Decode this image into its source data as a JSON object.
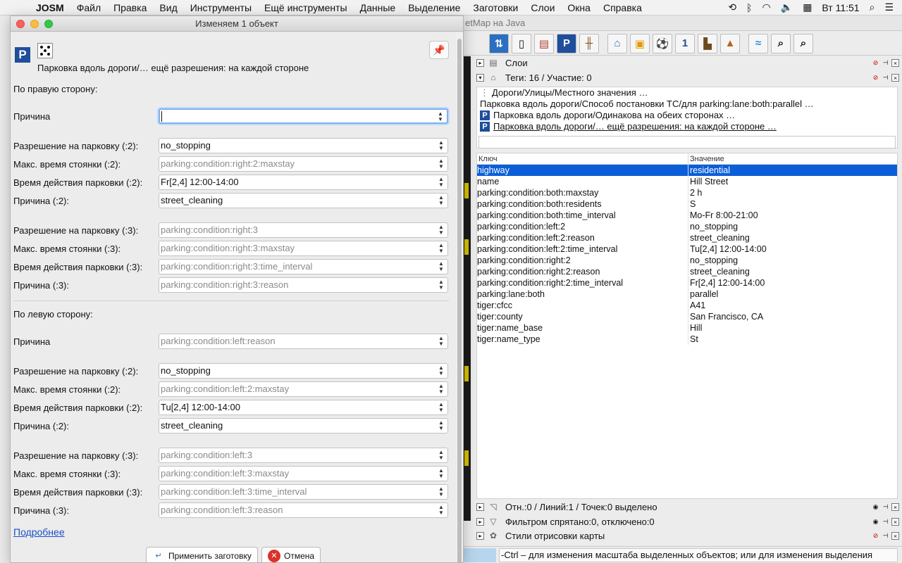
{
  "menubar": {
    "app": "JOSM",
    "items": [
      "Файл",
      "Правка",
      "Вид",
      "Инструменты",
      "Ещё инструменты",
      "Данные",
      "Выделение",
      "Заготовки",
      "Слои",
      "Окна",
      "Справка"
    ],
    "clock": "Вт 11:51"
  },
  "main": {
    "title_fragment": "etMap на Java",
    "layers_header": "Слои",
    "tags_header": "Теги: 16 / Участие: 0",
    "preset_lines": [
      "Дороги/Улицы/Местного значения …",
      "Парковка вдоль дороги/Способ постановки ТС/для parking:lane:both:parallel …",
      "Парковка вдоль дороги/Одинакова на обеих сторонах …",
      "Парковка вдоль дороги/… ещё разрешения: на каждой стороне …"
    ],
    "table": {
      "col_key": "Ключ",
      "col_value": "Значение",
      "rows": [
        {
          "k": "highway",
          "v": "residential"
        },
        {
          "k": "name",
          "v": "Hill Street"
        },
        {
          "k": "parking:condition:both:maxstay",
          "v": "2 h"
        },
        {
          "k": "parking:condition:both:residents",
          "v": "S"
        },
        {
          "k": "parking:condition:both:time_interval",
          "v": "Mo-Fr 8:00-21:00"
        },
        {
          "k": "parking:condition:left:2",
          "v": "no_stopping"
        },
        {
          "k": "parking:condition:left:2:reason",
          "v": "street_cleaning"
        },
        {
          "k": "parking:condition:left:2:time_interval",
          "v": "Tu[2,4] 12:00-14:00"
        },
        {
          "k": "parking:condition:right:2",
          "v": "no_stopping"
        },
        {
          "k": "parking:condition:right:2:reason",
          "v": "street_cleaning"
        },
        {
          "k": "parking:condition:right:2:time_interval",
          "v": "Fr[2,4] 12:00-14:00"
        },
        {
          "k": "parking:lane:both",
          "v": "parallel"
        },
        {
          "k": "tiger:cfcc",
          "v": "A41"
        },
        {
          "k": "tiger:county",
          "v": "San Francisco, CA"
        },
        {
          "k": "tiger:name_base",
          "v": "Hill"
        },
        {
          "k": "tiger:name_type",
          "v": "St"
        }
      ]
    },
    "selection_header": "Отн.:0 / Линий:1 / Точек:0 выделено",
    "filter_header": "Фильтром спрятано:0, отключено:0",
    "styles_header": "Стили отрисовки карты",
    "status_message": "-Ctrl – для изменения масштаба выделенных объектов; или для изменения выделения"
  },
  "dialog": {
    "title": "Изменяем 1 объект",
    "preset_name": "Парковка вдоль дороги/… ещё разрешения: на каждой стороне",
    "right_section": "По правую сторону:",
    "left_section": "По левую сторону:",
    "rows": [
      {
        "label": "Причина",
        "value": "",
        "placeholder": false
      },
      {
        "label": "Разрешение на парковку (:2):",
        "value": "no_stopping",
        "placeholder": false
      },
      {
        "label": "Макс. время стоянки (:2):",
        "value": "parking:condition:right:2:maxstay",
        "placeholder": true
      },
      {
        "label": "Время действия парковки (:2):",
        "value": "Fr[2,4] 12:00-14:00",
        "placeholder": false
      },
      {
        "label": "Причина (:2):",
        "value": "street_cleaning",
        "placeholder": false
      },
      {
        "label": "Разрешение на парковку (:3):",
        "value": "parking:condition:right:3",
        "placeholder": true
      },
      {
        "label": "Макс. время стоянки (:3):",
        "value": "parking:condition:right:3:maxstay",
        "placeholder": true
      },
      {
        "label": "Время действия парковки (:3):",
        "value": "parking:condition:right:3:time_interval",
        "placeholder": true
      },
      {
        "label": "Причина (:3):",
        "value": "parking:condition:right:3:reason",
        "placeholder": true
      },
      {
        "label": "Причина",
        "value": "parking:condition:left:reason",
        "placeholder": true
      },
      {
        "label": "Разрешение на парковку (:2):",
        "value": "no_stopping",
        "placeholder": false
      },
      {
        "label": "Макс. время стоянки (:2):",
        "value": "parking:condition:left:2:maxstay",
        "placeholder": true
      },
      {
        "label": "Время действия парковки (:2):",
        "value": "Tu[2,4] 12:00-14:00",
        "placeholder": false
      },
      {
        "label": "Причина (:2):",
        "value": "street_cleaning",
        "placeholder": false
      },
      {
        "label": "Разрешение на парковку (:3):",
        "value": "parking:condition:left:3",
        "placeholder": true
      },
      {
        "label": "Макс. время стоянки (:3):",
        "value": "parking:condition:left:3:maxstay",
        "placeholder": true
      },
      {
        "label": "Время действия парковки (:3):",
        "value": "parking:condition:left:3:time_interval",
        "placeholder": true
      },
      {
        "label": "Причина (:3):",
        "value": "parking:condition:left:3:reason",
        "placeholder": true
      }
    ],
    "more_link": "Подробнее",
    "apply_button": "Применить заготовку",
    "cancel_button": "Отмена"
  },
  "colors": {
    "selected_row": "#0b5ed7",
    "parking_icon": "#1f4e9c",
    "link": "#1a4fc4"
  }
}
